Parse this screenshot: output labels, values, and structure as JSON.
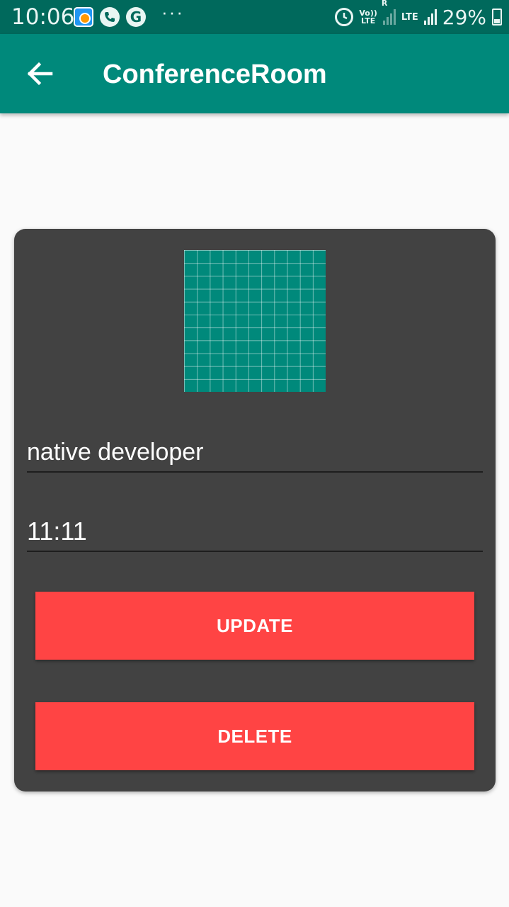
{
  "status_bar": {
    "time": "10:06",
    "more": "···",
    "network_left": "Vo))",
    "network_left2": "LTE",
    "roaming": "R",
    "lte": "LTE",
    "battery": "29%"
  },
  "app_bar": {
    "title": "ConferenceRoom"
  },
  "form": {
    "name_value": "native developer",
    "time_value": "11:11",
    "update_label": "UPDATE",
    "delete_label": "DELETE"
  },
  "colors": {
    "status_bar": "#00695c",
    "app_bar": "#00897b",
    "card": "#424242",
    "button": "#ff4444"
  }
}
